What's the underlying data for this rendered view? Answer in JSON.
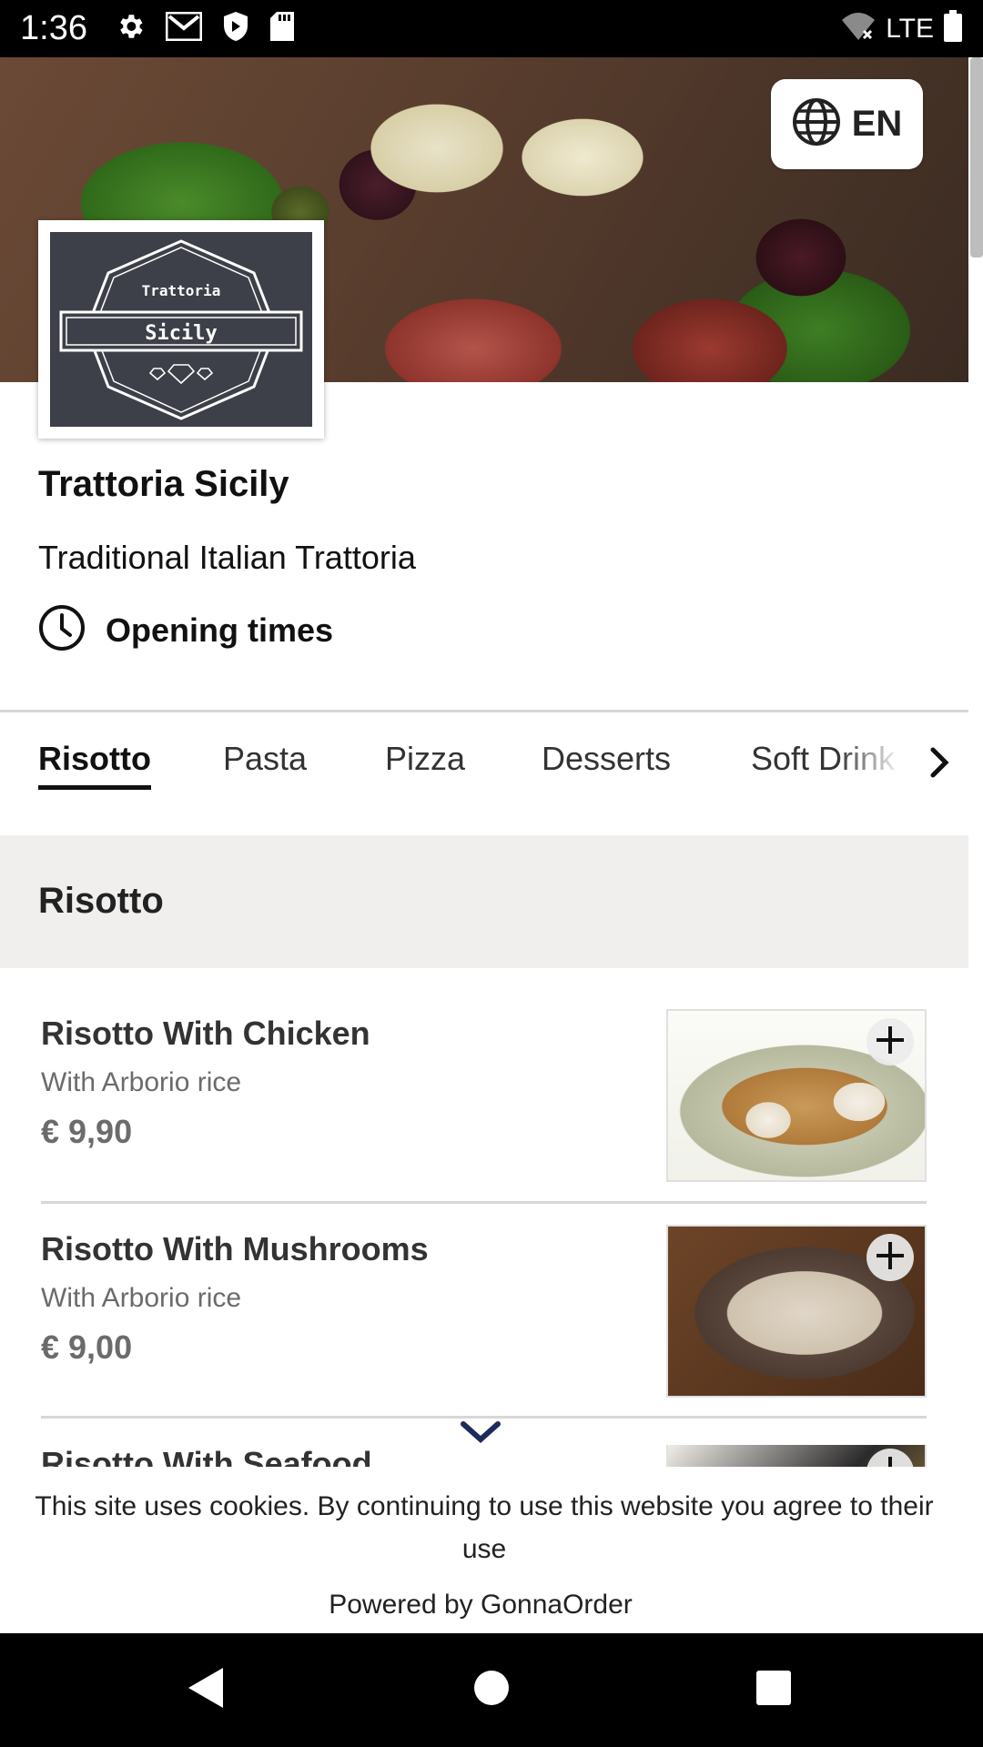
{
  "status_bar": {
    "time": "1:36",
    "network": "LTE",
    "icons": [
      "settings-icon",
      "gmail-icon",
      "shield-icon",
      "sd-card-icon",
      "wifi-off-icon",
      "battery-icon"
    ]
  },
  "header": {
    "language_label": "EN",
    "language_icon": "globe-icon"
  },
  "logo": {
    "line1": "Trattoria",
    "line2": "Sicily"
  },
  "restaurant": {
    "name": "Trattoria Sicily",
    "description": "Traditional Italian Trattoria",
    "opening_times_label": "Opening times"
  },
  "tabs": [
    {
      "label": "Risotto",
      "active": true
    },
    {
      "label": "Pasta",
      "active": false
    },
    {
      "label": "Pizza",
      "active": false
    },
    {
      "label": "Desserts",
      "active": false
    },
    {
      "label": "Soft Drink",
      "active": false
    }
  ],
  "section": {
    "title": "Risotto"
  },
  "items": [
    {
      "name": "Risotto With Chicken",
      "description": "With Arborio rice",
      "price": "€ 9,90"
    },
    {
      "name": "Risotto With Mushrooms",
      "description": "With Arborio rice",
      "price": "€ 9,00"
    },
    {
      "name": "Risotto With Seafood",
      "description": "",
      "price": ""
    }
  ],
  "cookie": {
    "text": "This site uses cookies. By continuing to use this website you agree to their use",
    "powered_by": "Powered by GonnaOrder"
  },
  "colors": {
    "accent": "#1f2a5c",
    "section_bg": "#f0efee",
    "logo_bg": "#3d4048"
  }
}
